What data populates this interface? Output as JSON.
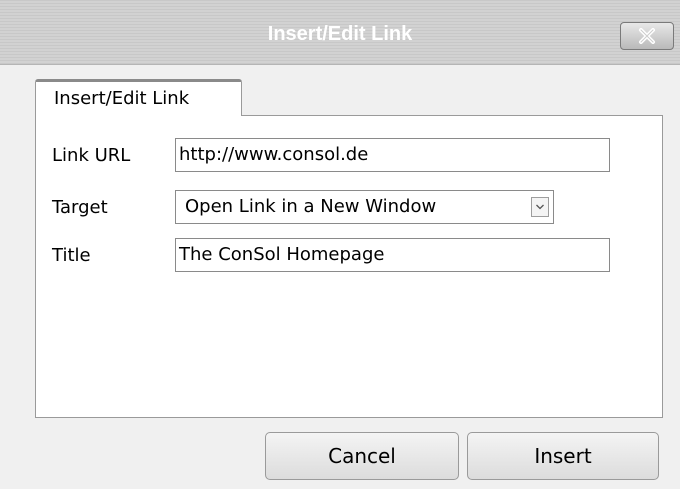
{
  "window": {
    "title": "Insert/Edit Link"
  },
  "tabs": [
    {
      "label": "Insert/Edit Link"
    }
  ],
  "form": {
    "link_url": {
      "label": "Link URL",
      "value": "http://www.consol.de"
    },
    "target": {
      "label": "Target",
      "selected": "Open Link in a New Window"
    },
    "title": {
      "label": "Title",
      "value": "The ConSol Homepage"
    }
  },
  "buttons": {
    "cancel": "Cancel",
    "insert": "Insert"
  },
  "icons": {
    "close": "close-icon",
    "dropdown": "chevron-down-icon"
  }
}
